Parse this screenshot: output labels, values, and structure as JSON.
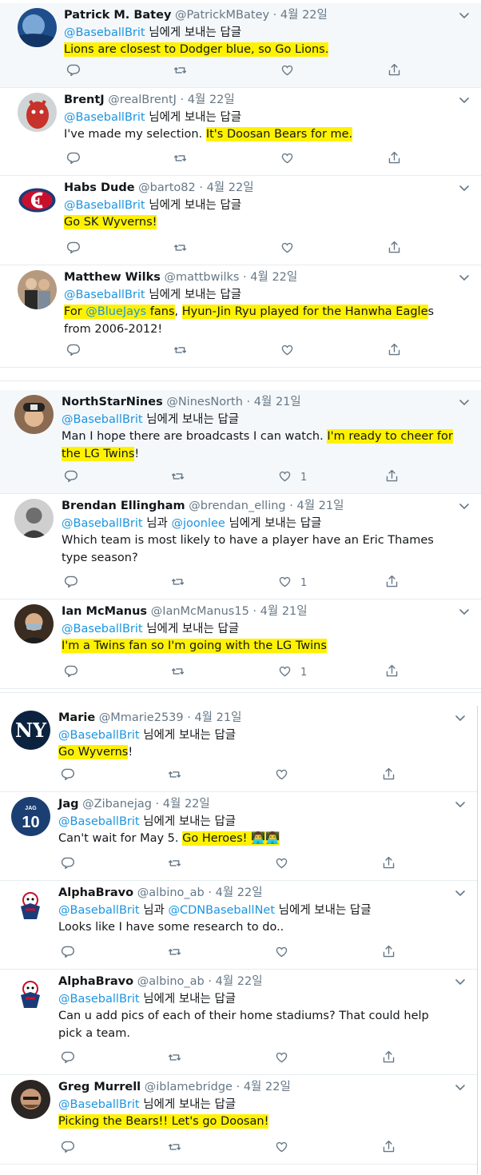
{
  "reply_prefix_single": "님에게 보내는 답글",
  "reply_prefix_multi_and": "님과",
  "tweets": [
    {
      "name": "Patrick M. Batey",
      "handle": "@PatrickMBatey",
      "date": "4월 22일",
      "reply": [
        "@BaseballBrit"
      ],
      "text_segments": [
        {
          "t": "Lions are closest to Dodger blue, so Go Lions.",
          "hl": true
        }
      ],
      "likes": "",
      "avatar": "blue-sky-photo"
    },
    {
      "name": "BrentJ",
      "handle": "@realBrentJ",
      "date": "4월 22일",
      "reply": [
        "@BaseballBrit"
      ],
      "text_segments": [
        {
          "t": "I've made my selection.  ",
          "hl": false
        },
        {
          "t": "It's Doosan Bears for me.",
          "hl": true
        }
      ],
      "likes": "",
      "avatar": "red-mascot-photo"
    },
    {
      "name": "Habs Dude",
      "handle": "@barto82",
      "date": "4월 22일",
      "reply": [
        "@BaseballBrit"
      ],
      "text_segments": [
        {
          "t": "Go SK Wyverns!",
          "hl": true
        }
      ],
      "likes": "",
      "avatar": "canadiens-logo"
    },
    {
      "name": "Matthew Wilks",
      "handle": "@mattbwilks",
      "date": "4월 22일",
      "reply": [
        "@BaseballBrit"
      ],
      "text_segments": [
        {
          "t": "For ",
          "hl": true
        },
        {
          "t": "@BlueJays",
          "hl": true,
          "mention": true
        },
        {
          "t": " fans",
          "hl": true
        },
        {
          "t": ", ",
          "hl": false
        },
        {
          "t": "Hyun-Jin Ryu played for the Hanwha Eagle",
          "hl": true
        },
        {
          "t": "s from 2006-2012!",
          "hl": false
        }
      ],
      "likes": "",
      "avatar": "couple-photo"
    },
    {
      "name": "NorthStarNines",
      "handle": "@NinesNorth",
      "date": "4월 21일",
      "reply": [
        "@BaseballBrit"
      ],
      "text_segments": [
        {
          "t": "Man I hope there are broadcasts I can watch. ",
          "hl": false
        },
        {
          "t": "I'm ready to cheer for the LG Twins",
          "hl": true
        },
        {
          "t": "!",
          "hl": false
        }
      ],
      "likes": "1",
      "avatar": "cap-man-photo"
    },
    {
      "name": "Brendan Ellingham",
      "handle": "@brendan_elling",
      "date": "4월 21일",
      "reply": [
        "@BaseballBrit",
        "@joonlee"
      ],
      "text_segments": [
        {
          "t": "Which team is most likely to have a player have an Eric Thames type season?",
          "hl": false
        }
      ],
      "likes": "1",
      "avatar": "bw-portrait"
    },
    {
      "name": "Ian McManus",
      "handle": "@IanMcManus15",
      "date": "4월 21일",
      "reply": [
        "@BaseballBrit"
      ],
      "text_segments": [
        {
          "t": "I'm a Twins fan so I'm going with the LG Twins",
          "hl": true
        }
      ],
      "likes": "1",
      "avatar": "masked-man-photo"
    },
    {
      "name": "Marie",
      "handle": "@Mmarie2539",
      "date": "4월 21일",
      "reply": [
        "@BaseballBrit"
      ],
      "text_segments": [
        {
          "t": "Go Wyverns",
          "hl": true
        },
        {
          "t": "!",
          "hl": false
        }
      ],
      "likes": "",
      "avatar": "yankees-logo"
    },
    {
      "name": "Jag",
      "handle": "@Zibanejag",
      "date": "4월 22일",
      "reply": [
        "@BaseballBrit"
      ],
      "text_segments": [
        {
          "t": "Can't wait for May 5. ",
          "hl": false
        },
        {
          "t": "Go Heroes! 👨‍💻👨‍💻",
          "hl": true
        }
      ],
      "likes": "",
      "avatar": "jersey-10"
    },
    {
      "name": "AlphaBravo",
      "handle": "@albino_ab",
      "date": "4월 22일",
      "reply": [
        "@BaseballBrit",
        "@CDNBaseballNet"
      ],
      "text_segments": [
        {
          "t": "Looks like I have some research to do..",
          "hl": false
        }
      ],
      "likes": "",
      "avatar": "cartoon-mascot"
    },
    {
      "name": "AlphaBravo",
      "handle": "@albino_ab",
      "date": "4월 22일",
      "reply": [
        "@BaseballBrit"
      ],
      "text_segments": [
        {
          "t": "Can u add pics of each of their home stadiums? That could help pick a team.",
          "hl": false
        }
      ],
      "likes": "",
      "avatar": "cartoon-mascot"
    },
    {
      "name": "Greg Murrell",
      "handle": "@iblamebridge",
      "date": "4월 22일",
      "reply": [
        "@BaseballBrit"
      ],
      "text_segments": [
        {
          "t": "Picking the Bears!!  Let's go Doosan!",
          "hl": true
        }
      ],
      "likes": "",
      "avatar": "bald-man-photo"
    }
  ],
  "colors": {
    "mention": "#1b95e0",
    "highlight": "#fff200",
    "meta": "#657786",
    "shaded_bg": "#f5f8fa"
  },
  "icons": [
    "reply-icon",
    "retweet-icon",
    "like-icon",
    "share-icon",
    "chevron-down-icon"
  ]
}
